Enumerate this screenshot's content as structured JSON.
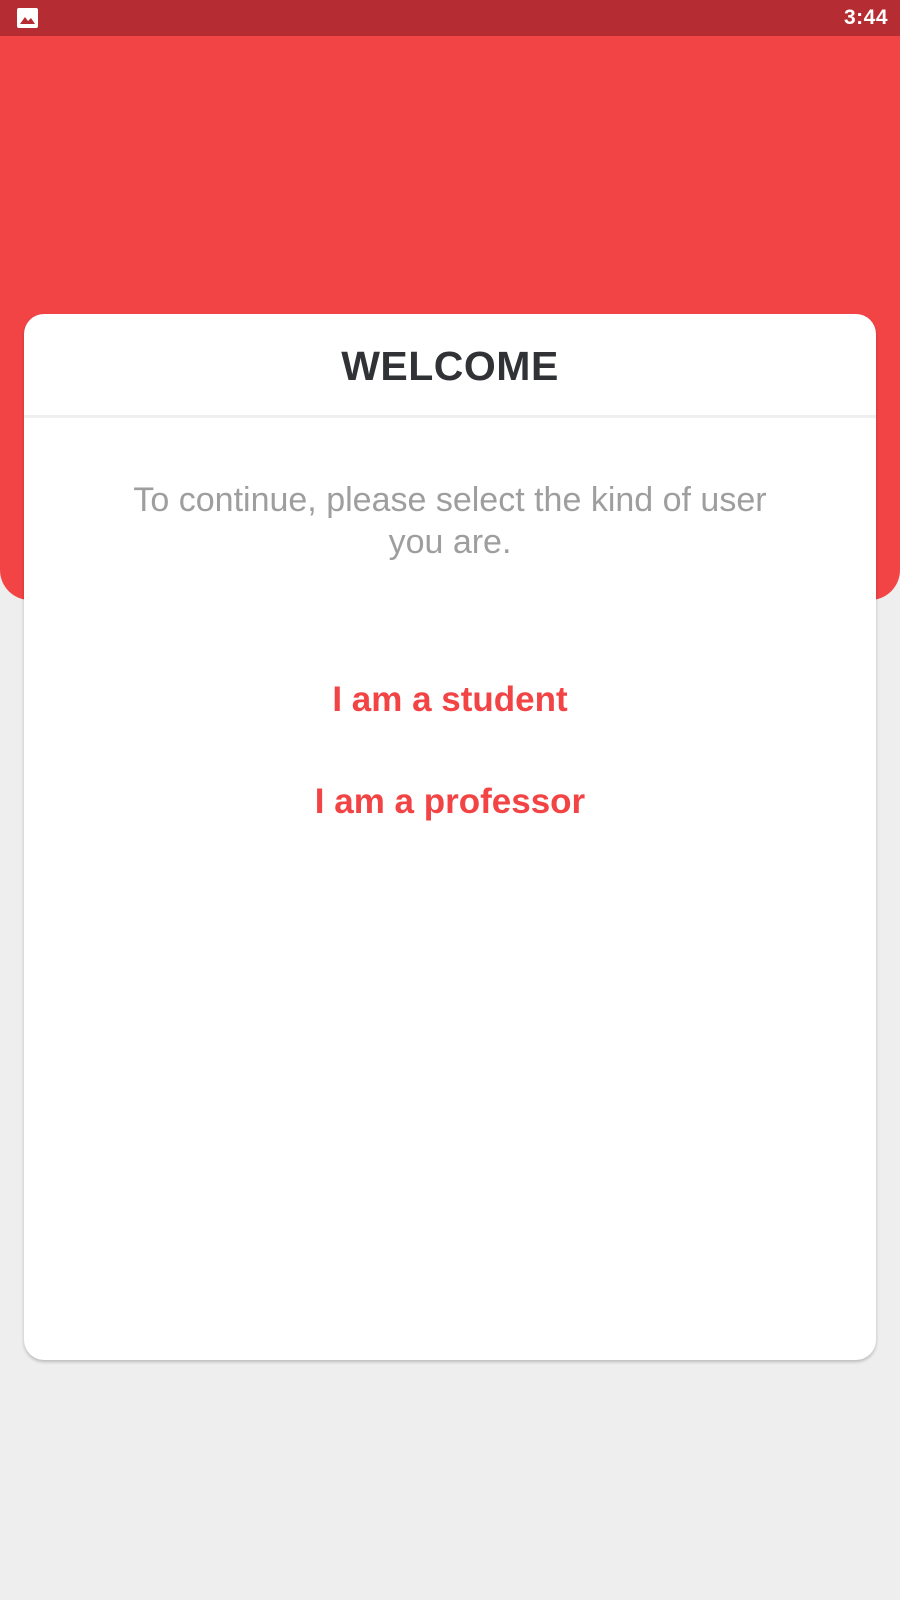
{
  "status_bar": {
    "time": "3:44",
    "icon": "image-icon",
    "color": "#b52d32"
  },
  "theme": {
    "accent": "#f24445",
    "background": "#eeeeee",
    "title_color": "#303236",
    "subtitle_color": "#9e9e9e"
  },
  "card": {
    "title": "WELCOME",
    "subtitle": "To continue, please select the kind of user you are.",
    "options": [
      {
        "label": "I am a student"
      },
      {
        "label": "I am a professor"
      }
    ]
  }
}
